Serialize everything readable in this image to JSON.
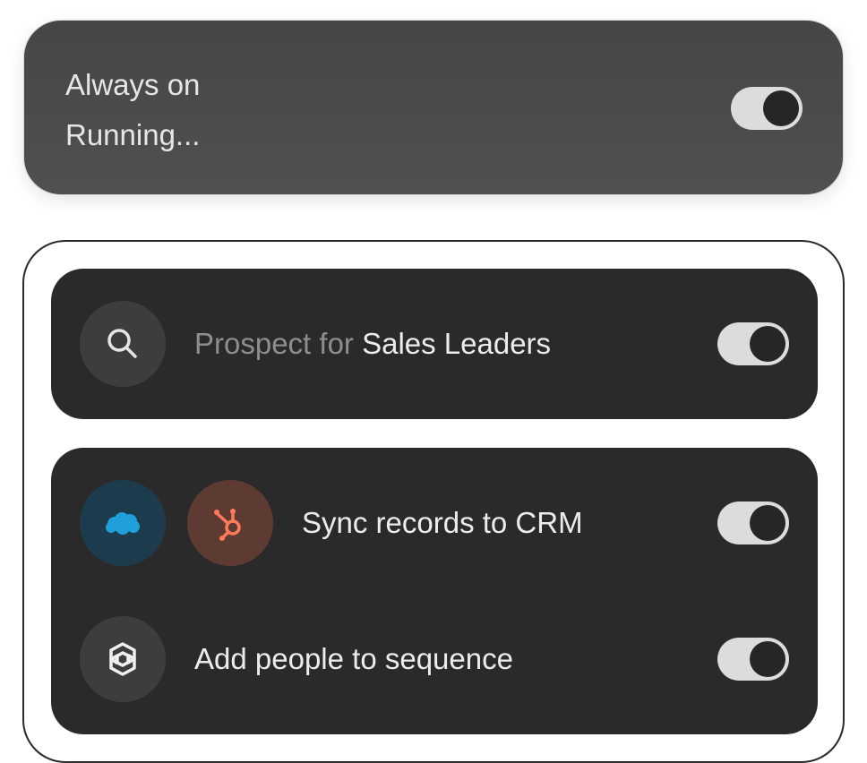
{
  "status": {
    "title": "Always on",
    "subtitle": "Running...",
    "toggle_on": true
  },
  "steps": {
    "prospect": {
      "icon": "search-icon",
      "prefix": "Prospect for ",
      "target": "Sales Leaders",
      "toggle_on": true
    },
    "sync": {
      "icons": [
        "salesforce-icon",
        "hubspot-icon"
      ],
      "label": "Sync records to CRM",
      "toggle_on": true
    },
    "sequence": {
      "icon": "sequence-icon",
      "label": "Add people to sequence",
      "toggle_on": true
    }
  },
  "colors": {
    "card_dark": "#2a2a2a",
    "status_card": "#4a4a4a",
    "toggle_track": "#dcdcdc",
    "toggle_knob": "#262626",
    "salesforce_blue": "#1fa0db",
    "hubspot_orange": "#ff7a59"
  }
}
